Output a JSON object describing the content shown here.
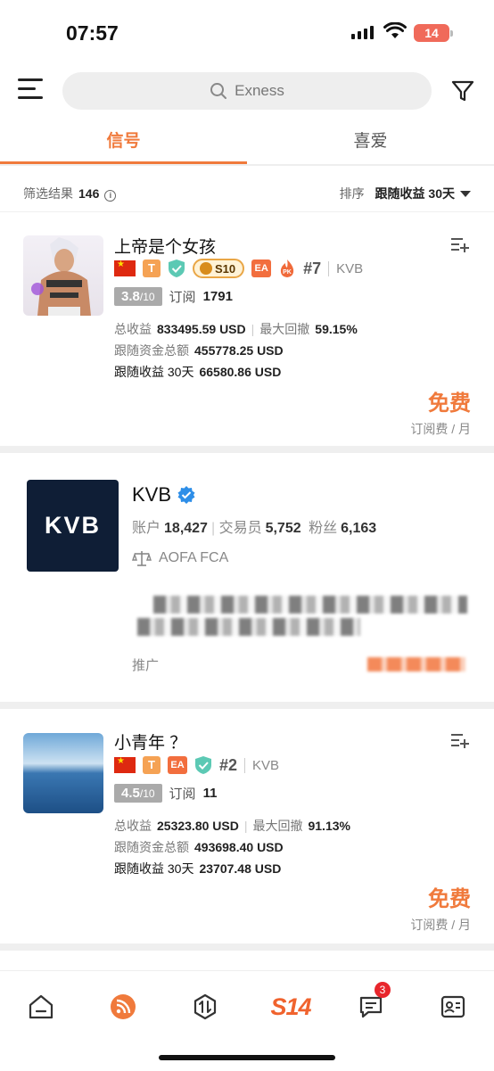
{
  "status_bar": {
    "time": "07:57",
    "battery": "14"
  },
  "header": {
    "search_placeholder": "Exness"
  },
  "tabs": [
    {
      "label": "信号",
      "active": true
    },
    {
      "label": "喜爱",
      "active": false
    }
  ],
  "results": {
    "label": "筛选结果",
    "count": "146",
    "sort_label": "排序",
    "sort_value": "跟随收益 30天"
  },
  "signals": [
    {
      "name": "上帝是个女孩",
      "level_badge": "S10",
      "rank": "#7",
      "broker": "KVB",
      "rating": "3.8",
      "rating_max": "/10",
      "subs_label": "订阅",
      "subs": "1791",
      "total_profit_label": "总收益",
      "total_profit": "833495.59 USD",
      "max_dd_label": "最大回撤",
      "max_dd": "59.15%",
      "follow_funds_label": "跟随资金总额",
      "follow_funds": "455778.25 USD",
      "follow_profit_label": "跟随收益 30天",
      "follow_profit": "66580.86 USD",
      "price": "免费",
      "price_unit": "订阅费 / 月"
    },
    {
      "name": "小青年 ？",
      "rank": "#2",
      "broker": "KVB",
      "rating": "4.5",
      "rating_max": "/10",
      "subs_label": "订阅",
      "subs": "11",
      "total_profit_label": "总收益",
      "total_profit": "25323.80 USD",
      "max_dd_label": "最大回撤",
      "max_dd": "91.13%",
      "follow_funds_label": "跟随资金总额",
      "follow_funds": "493698.40 USD",
      "follow_profit_label": "跟随收益 30天",
      "follow_profit": "23707.48 USD",
      "price": "免费",
      "price_unit": "订阅费 / 月"
    }
  ],
  "promo": {
    "logo_text": "KVB",
    "name": "KVB",
    "accounts_label": "账户",
    "accounts": "18,427",
    "traders_label": "交易员",
    "traders": "5,752",
    "fans_label": "粉丝",
    "fans": "6,163",
    "regulators": "AOFA  FCA",
    "label": "推广"
  },
  "bottom_nav": {
    "brand": "S14",
    "messages_badge": "3"
  },
  "colors": {
    "accent": "#f07a3c",
    "kvb_navy": "#0f1e36"
  }
}
